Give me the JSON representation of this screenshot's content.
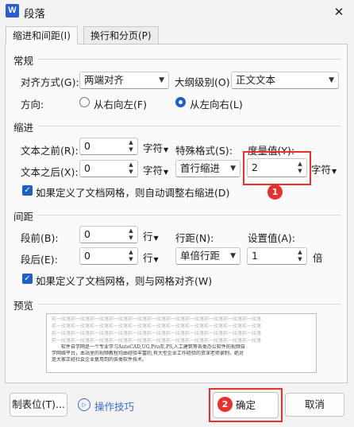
{
  "window": {
    "app_icon_letter": "W",
    "title": "段落",
    "close_glyph": "✕"
  },
  "tabs": [
    {
      "label": "缩进和间距(I)",
      "active": true
    },
    {
      "label": "换行和分页(P)",
      "active": false
    }
  ],
  "general": {
    "section_title": "常规",
    "alignment_label": "对齐方式(G):",
    "alignment_value": "两端对齐",
    "outline_label": "大纲级别(O):",
    "outline_value": "正文文本",
    "direction_label": "方向:",
    "direction_rtl": "从右向左(F)",
    "direction_ltr": "从左向右(L)",
    "direction_selected": "ltr"
  },
  "indent": {
    "section_title": "缩进",
    "before_label": "文本之前(R):",
    "before_value": "0",
    "before_unit": "字符",
    "after_label": "文本之后(X):",
    "after_value": "0",
    "after_unit": "字符",
    "special_label": "特殊格式(S):",
    "special_value": "首行缩进",
    "measure_label": "度量值(Y):",
    "measure_value": "2",
    "measure_unit": "字符",
    "grid_checkbox_label": "如果定义了文档网格，则自动调整右缩进(D)",
    "grid_checkbox_checked": true
  },
  "spacing": {
    "section_title": "间距",
    "before_label": "段前(B):",
    "before_value": "0",
    "before_unit": "行",
    "after_label": "段后(E):",
    "after_value": "0",
    "after_unit": "行",
    "line_label": "行距(N):",
    "line_value": "单倍行距",
    "setting_label": "设置值(A):",
    "setting_value": "1",
    "setting_unit": "倍",
    "grid_checkbox_label": "如果定义了文档网格，则与网格对齐(W)",
    "grid_checkbox_checked": true
  },
  "preview": {
    "section_title": "预览",
    "ghost_line": "前一段落前一段落前一段落前一段落前一段落前一段落前一段落前一段落前一段落前一段落前一段落",
    "sample_lines": [
      "软件自学网是一个专业学习AutoCAD,UG,Pro/E,PS,人工建筑等各类办公软件的视频自",
      "学网络平台，本站里的视频教程均由经验丰富的,有大型企业工作经验的资深老师录制，绝对",
      "是大家正经社会企业复用到的各类软件技术。"
    ]
  },
  "annotations": {
    "badge1": "1",
    "badge2": "2"
  },
  "buttons": {
    "tabstops": "制表位(T)...",
    "tips_icon": "▷",
    "tips": "操作技巧",
    "ok": "确定",
    "cancel": "取消"
  }
}
